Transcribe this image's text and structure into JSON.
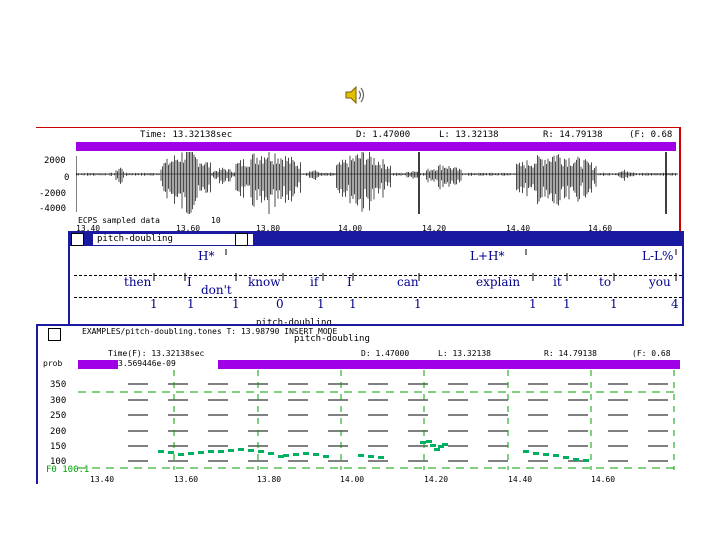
{
  "icons": {
    "speaker": "speaker-icon"
  },
  "waveform": {
    "header": {
      "time": "Time: 13.32138sec",
      "d": "D: 1.47000",
      "l": "L: 13.32138",
      "r": "R: 14.79138",
      "f": "(F: 0.68"
    },
    "y_ticks": [
      "2000",
      "0",
      "-2000",
      "-4000"
    ],
    "footer_label": "ECPS sampled data",
    "x_ticks": [
      "13.40",
      "13.60",
      "13.80",
      "14.00",
      "14.20",
      "14.40",
      "14.60"
    ],
    "footer_extra": "10"
  },
  "tone_window": {
    "title": "pitch-doubling",
    "tones": [
      "H*",
      "L+H*",
      "L-L%"
    ],
    "words": [
      "then",
      "I",
      "don't",
      "know",
      "if",
      "I",
      "can",
      "explain",
      "it",
      "to",
      "you"
    ],
    "breaks": [
      "1",
      "1",
      "1",
      "0",
      "1",
      "1",
      "1",
      "1",
      "1",
      "1",
      "4"
    ],
    "footer": "pitch-doubling"
  },
  "pitch_window": {
    "title_bar": "EXAMPLES/pitch-doubling.tones    T: 13.98790    INSERT MODE",
    "title_bar_overlay": "pitch-doubling",
    "header": {
      "time": "Time(F): 13.32138sec",
      "d": "D: 1.47000",
      "l": "L: 13.32138",
      "r": "R: 14.79138",
      "f": "(F: 0.68"
    },
    "prob_label": "prob",
    "prob_value": "3.569446e-09",
    "y_ticks": [
      "350",
      "300",
      "250",
      "200",
      "150",
      "100"
    ],
    "footer_val": "F0 100.1",
    "x_ticks": [
      "13.40",
      "13.60",
      "13.80",
      "14.00",
      "14.20",
      "14.40",
      "14.60"
    ]
  }
}
